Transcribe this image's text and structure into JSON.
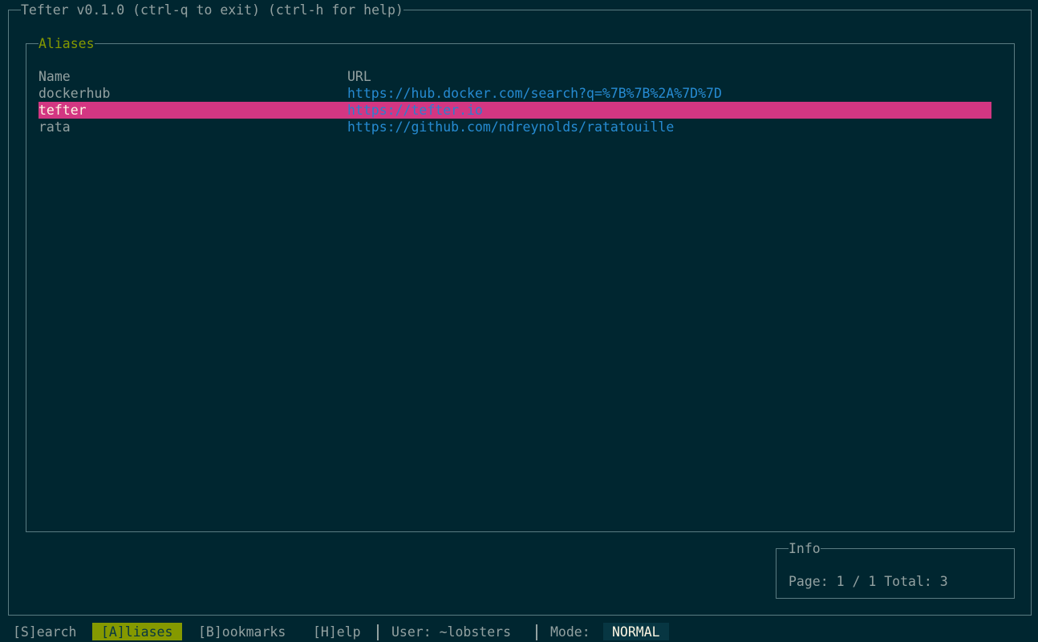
{
  "app": {
    "title": "Tefter v0.1.0 (ctrl-q to exit) (ctrl-h for help)"
  },
  "aliases_panel": {
    "title": "Aliases",
    "columns": {
      "name": "Name",
      "url": "URL"
    },
    "rows": [
      {
        "name": "dockerhub",
        "url": "https://hub.docker.com/search?q=%7B%7B%2A%7D%7D",
        "selected": false
      },
      {
        "name": "tefter",
        "url": "https://tefter.io",
        "selected": true
      },
      {
        "name": "rata",
        "url": "https://github.com/ndreynolds/ratatouille",
        "selected": false
      }
    ]
  },
  "info_panel": {
    "title": "Info",
    "text": "Page: 1 / 1 Total: 3"
  },
  "statusbar": {
    "tabs": [
      {
        "label": "[S]earch",
        "active": false
      },
      {
        "label": "[A]liases",
        "active": true
      },
      {
        "label": "[B]ookmarks",
        "active": false
      },
      {
        "label": "[H]elp",
        "active": false
      }
    ],
    "user": "User: ~lobsters",
    "mode_label": "Mode:",
    "mode_value": "NORMAL"
  },
  "colors": {
    "background": "#002630",
    "border": "#5b7c82",
    "panel_title": "#859900",
    "text": "#93a1a1",
    "url": "#268bd2",
    "selected_row": "#d33682",
    "active_tab": "#859900",
    "mode_badge": "#073642"
  }
}
